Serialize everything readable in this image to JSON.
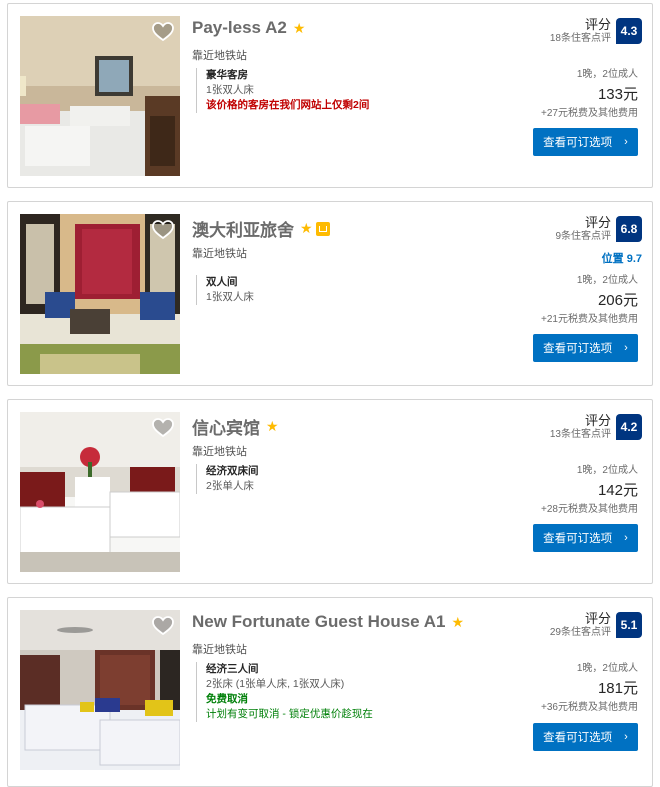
{
  "hotels": [
    {
      "name": "Pay-less A2",
      "location": "靠近地铁站",
      "room_type": "豪华客房",
      "beds": "1张双人床",
      "alert": "该价格的客房在我们网站上仅剩2间",
      "score_label": "评分",
      "reviews": "18条住客点评",
      "score": "4.3",
      "nights_guests": "1晚，2位成人",
      "price": "133元",
      "taxes": "+27元税费及其他费用",
      "cta": "查看可订选项"
    },
    {
      "name": "澳大利亚旅舍",
      "location": "靠近地铁站",
      "room_type": "双人间",
      "beds": "1张双人床",
      "score_label": "评分",
      "reviews": "9条住客点评",
      "score": "6.8",
      "location_score": "位置 9.7",
      "nights_guests": "1晚，2位成人",
      "price": "206元",
      "taxes": "+21元税费及其他费用",
      "cta": "查看可订选项"
    },
    {
      "name": "信心宾馆",
      "location": "靠近地铁站",
      "room_type": "经济双床间",
      "beds": "2张单人床",
      "score_label": "评分",
      "reviews": "13条住客点评",
      "score": "4.2",
      "nights_guests": "1晚，2位成人",
      "price": "142元",
      "taxes": "+28元税费及其他费用",
      "cta": "查看可订选项"
    },
    {
      "name": "New Fortunate Guest House A1",
      "location": "靠近地铁站",
      "room_type": "经济三人间",
      "beds": "2张床 (1张单人床, 1张双人床)",
      "free_cancel": "免费取消",
      "free_cancel_sub": "计划有变可取消 - 锁定优惠价趁现在",
      "score_label": "评分",
      "reviews": "29条住客点评",
      "score": "5.1",
      "nights_guests": "1晚，2位成人",
      "price": "181元",
      "taxes": "+36元税费及其他费用",
      "cta": "查看可订选项"
    }
  ],
  "icons": {
    "star": "★",
    "favorite": "heart-outline-icon",
    "chevron": "›"
  },
  "colors": {
    "score_box": "#003580",
    "cta": "#0071c2",
    "alert": "#c00000",
    "free_cancel": "#008009",
    "star": "#febb02"
  }
}
